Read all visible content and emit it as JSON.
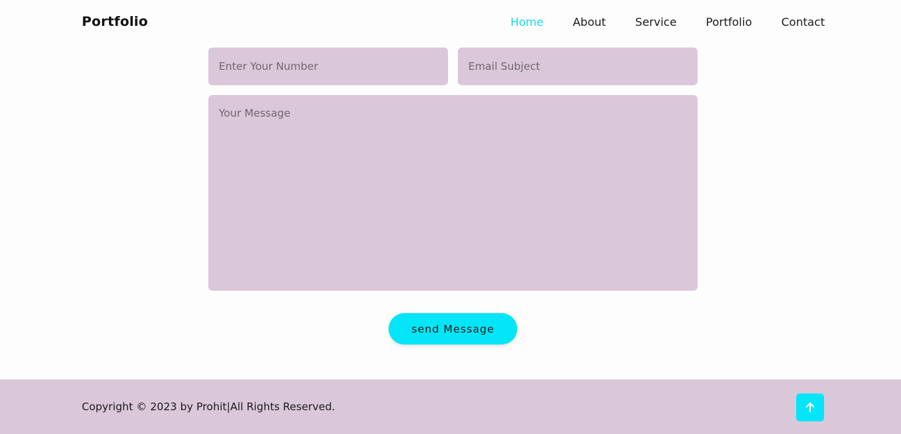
{
  "header": {
    "logo": "Portfolio",
    "nav": [
      {
        "label": "Home",
        "active": true
      },
      {
        "label": "About",
        "active": false
      },
      {
        "label": "Service",
        "active": false
      },
      {
        "label": "Portfolio",
        "active": false
      },
      {
        "label": "Contact",
        "active": false
      }
    ]
  },
  "form": {
    "number_placeholder": "Enter Your Number",
    "subject_placeholder": "Email Subject",
    "message_placeholder": "Your Message",
    "submit_label": "send Message"
  },
  "footer": {
    "copyright": "Copyright © 2023 by Prohit|All Rights Reserved.",
    "top_icon": "arrow-up-icon"
  },
  "colors": {
    "accent": "#04e6f7",
    "active_nav": "#13dcf0",
    "panel": "#dbc7da"
  }
}
